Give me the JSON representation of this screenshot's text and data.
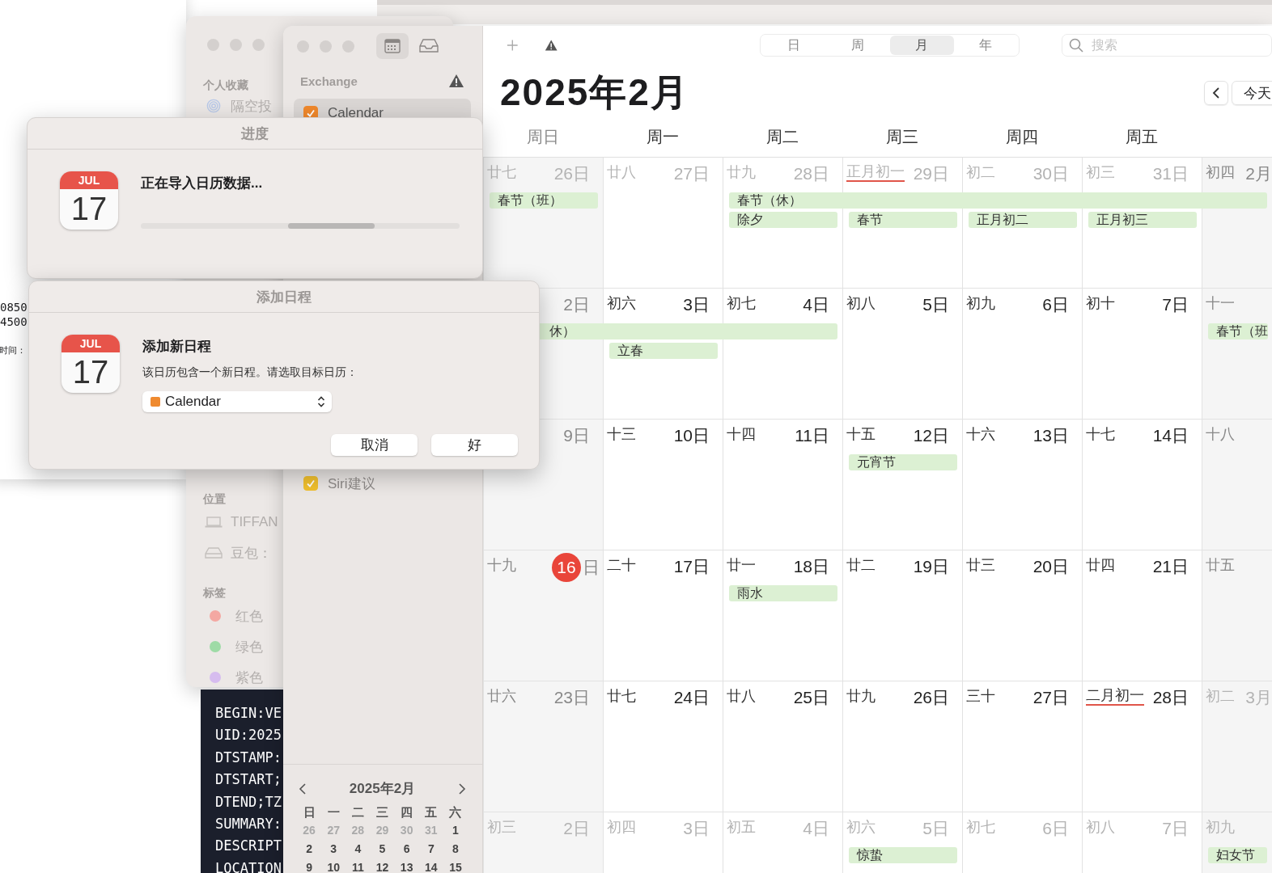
{
  "text_window": {
    "lines": [
      {
        "text": "0850"
      },
      {
        "text": "4500"
      },
      {
        "text": "时间：",
        "gap_before": true
      }
    ]
  },
  "back_sidebar": {
    "sections": [
      {
        "heading": "个人收藏",
        "items": [
          {
            "kind": "airdrop",
            "label": "隔空投"
          }
        ]
      },
      {
        "heading": "位置",
        "items": [
          {
            "kind": "laptop",
            "label": "TIFFAN"
          },
          {
            "kind": "drive",
            "label": "豆包："
          }
        ]
      },
      {
        "heading": "标签",
        "items": [
          {
            "kind": "tag",
            "label": "红色",
            "color": "#f4a8a2"
          },
          {
            "kind": "tag",
            "label": "绿色",
            "color": "#9edba6"
          },
          {
            "kind": "tag",
            "label": "紫色",
            "color": "#d6bcef"
          }
        ]
      }
    ]
  },
  "terminal": {
    "lines": [
      "BEGIN:VE",
      "UID:2025",
      "DTSTAMP:",
      "DTSTART;",
      "DTEND;TZ",
      "SUMMARY:",
      "DESCRIPT",
      "LOCATION"
    ]
  },
  "calendar_window": {
    "sidebar": {
      "calendar_list_button": {
        "selected": true
      },
      "account": "Exchange",
      "calendars": [
        {
          "label": "Calendar",
          "checked": true,
          "selected": true,
          "color": "#f0882c"
        },
        {
          "label": "Siri建议",
          "checked": true,
          "selected": false,
          "color": "#f2c12e"
        }
      ],
      "mini_calendar": {
        "title": "2025年2月",
        "weekdays": [
          "日",
          "一",
          "二",
          "三",
          "四",
          "五",
          "六"
        ],
        "weeks": [
          [
            {
              "d": "26",
              "out": true
            },
            {
              "d": "27",
              "out": true
            },
            {
              "d": "28",
              "out": true
            },
            {
              "d": "29",
              "out": true
            },
            {
              "d": "30",
              "out": true
            },
            {
              "d": "31",
              "out": true
            },
            {
              "d": "1",
              "out": false
            }
          ],
          [
            {
              "d": "2",
              "out": false
            },
            {
              "d": "3",
              "out": false
            },
            {
              "d": "4",
              "out": false
            },
            {
              "d": "5",
              "out": false
            },
            {
              "d": "6",
              "out": false
            },
            {
              "d": "7",
              "out": false
            },
            {
              "d": "8",
              "out": false
            }
          ],
          [
            {
              "d": "9",
              "out": false
            },
            {
              "d": "10",
              "out": false
            },
            {
              "d": "11",
              "out": false
            },
            {
              "d": "12",
              "out": false
            },
            {
              "d": "13",
              "out": false
            },
            {
              "d": "14",
              "out": false
            },
            {
              "d": "15",
              "out": false
            }
          ]
        ]
      }
    },
    "toolbar": {
      "views": [
        {
          "label": "日",
          "selected": false
        },
        {
          "label": "周",
          "selected": false
        },
        {
          "label": "月",
          "selected": true
        },
        {
          "label": "年",
          "selected": false
        }
      ],
      "search": {
        "placeholder": "搜索"
      }
    },
    "title": "2025年2月",
    "today_button": "今天",
    "weekdays": [
      "周日",
      "周一",
      "周二",
      "周三",
      "周四",
      "周五"
    ],
    "weeks": [
      {
        "days": [
          {
            "lunar": "廿七",
            "num": "26",
            "unit": "日",
            "out": true,
            "events": [
              {
                "label": "春节（班）"
              }
            ]
          },
          {
            "lunar": "廿八",
            "num": "27",
            "unit": "日",
            "out": true
          },
          {
            "lunar": "廿九",
            "num": "28",
            "unit": "日",
            "out": true,
            "events": [
              {
                "label": "春节（休）"
              },
              {
                "label": "除夕"
              }
            ]
          },
          {
            "lunar": "正月初一",
            "num": "29",
            "unit": "日",
            "out": true,
            "underlined": true,
            "events": [
              {
                "continues": true
              },
              {
                "label": "春节"
              }
            ]
          },
          {
            "lunar": "初二",
            "num": "30",
            "unit": "日",
            "out": true,
            "events": [
              {
                "continues": true
              },
              {
                "label": "正月初二"
              }
            ]
          },
          {
            "lunar": "初三",
            "num": "31",
            "unit": "日",
            "out": true,
            "events": [
              {
                "continues": true
              },
              {
                "label": "正月初三"
              }
            ]
          },
          {
            "lunar": "初四",
            "num": "2",
            "unit": "月",
            "events": [
              {
                "continues": true
              }
            ]
          }
        ]
      },
      {
        "days": [
          {
            "num": "2",
            "unit": "日",
            "events": [
              {
                "label": "休）",
                "continued": true
              }
            ]
          },
          {
            "lunar": "初六",
            "num": "3",
            "unit": "日",
            "events": [
              {
                "continues": true
              },
              {
                "label": "立春"
              }
            ]
          },
          {
            "lunar": "初七",
            "num": "4",
            "unit": "日",
            "events": [
              {
                "continues": true
              }
            ]
          },
          {
            "lunar": "初八",
            "num": "5",
            "unit": "日"
          },
          {
            "lunar": "初九",
            "num": "6",
            "unit": "日"
          },
          {
            "lunar": "初十",
            "num": "7",
            "unit": "日"
          },
          {
            "lunar": "十一",
            "events": [
              {
                "label": "春节（班"
              }
            ]
          }
        ]
      },
      {
        "days": [
          {
            "num": "9",
            "unit": "日"
          },
          {
            "lunar": "十三",
            "num": "10",
            "unit": "日"
          },
          {
            "lunar": "十四",
            "num": "11",
            "unit": "日"
          },
          {
            "lunar": "十五",
            "num": "12",
            "unit": "日",
            "events": [
              {
                "label": "元宵节"
              }
            ]
          },
          {
            "lunar": "十六",
            "num": "13",
            "unit": "日"
          },
          {
            "lunar": "十七",
            "num": "14",
            "unit": "日"
          },
          {
            "lunar": "十八"
          }
        ]
      },
      {
        "days": [
          {
            "lunar": "十九",
            "num": "16",
            "unit": "日",
            "today": true
          },
          {
            "lunar": "二十",
            "num": "17",
            "unit": "日"
          },
          {
            "lunar": "廿一",
            "num": "18",
            "unit": "日",
            "events": [
              {
                "label": "雨水"
              }
            ]
          },
          {
            "lunar": "廿二",
            "num": "19",
            "unit": "日"
          },
          {
            "lunar": "廿三",
            "num": "20",
            "unit": "日"
          },
          {
            "lunar": "廿四",
            "num": "21",
            "unit": "日"
          },
          {
            "lunar": "廿五"
          }
        ]
      },
      {
        "days": [
          {
            "lunar": "廿六",
            "num": "23",
            "unit": "日"
          },
          {
            "lunar": "廿七",
            "num": "24",
            "unit": "日"
          },
          {
            "lunar": "廿八",
            "num": "25",
            "unit": "日"
          },
          {
            "lunar": "廿九",
            "num": "26",
            "unit": "日"
          },
          {
            "lunar": "三十",
            "num": "27",
            "unit": "日"
          },
          {
            "lunar": "二月初一",
            "num": "28",
            "unit": "日",
            "underlined": true
          },
          {
            "lunar": "初二",
            "num": "3",
            "unit": "月",
            "out": true
          }
        ]
      },
      {
        "days": [
          {
            "lunar": "初三",
            "num": "2",
            "unit": "日",
            "out": true
          },
          {
            "lunar": "初四",
            "num": "3",
            "unit": "日",
            "out": true
          },
          {
            "lunar": "初五",
            "num": "4",
            "unit": "日",
            "out": true
          },
          {
            "lunar": "初六",
            "num": "5",
            "unit": "日",
            "out": true,
            "events": [
              {
                "label": "惊蛰"
              }
            ]
          },
          {
            "lunar": "初七",
            "num": "6",
            "unit": "日",
            "out": true
          },
          {
            "lunar": "初八",
            "num": "7",
            "unit": "日",
            "out": true
          },
          {
            "lunar": "初九",
            "out": true,
            "events": [
              {
                "label": "妇女节"
              }
            ]
          }
        ]
      }
    ]
  },
  "progress_dialog": {
    "title": "进度",
    "icon_month": "JUL",
    "icon_day": "17",
    "message": "正在导入日历数据...",
    "indeterminate": true
  },
  "add_dialog": {
    "title": "添加日程",
    "icon_month": "JUL",
    "icon_day": "17",
    "heading": "添加新日程",
    "message": "该日历包含一个新日程。请选取目标日历：",
    "calendar_select": {
      "value": "Calendar",
      "color": "#ef8a2f"
    },
    "buttons": [
      "取消",
      "好"
    ]
  }
}
